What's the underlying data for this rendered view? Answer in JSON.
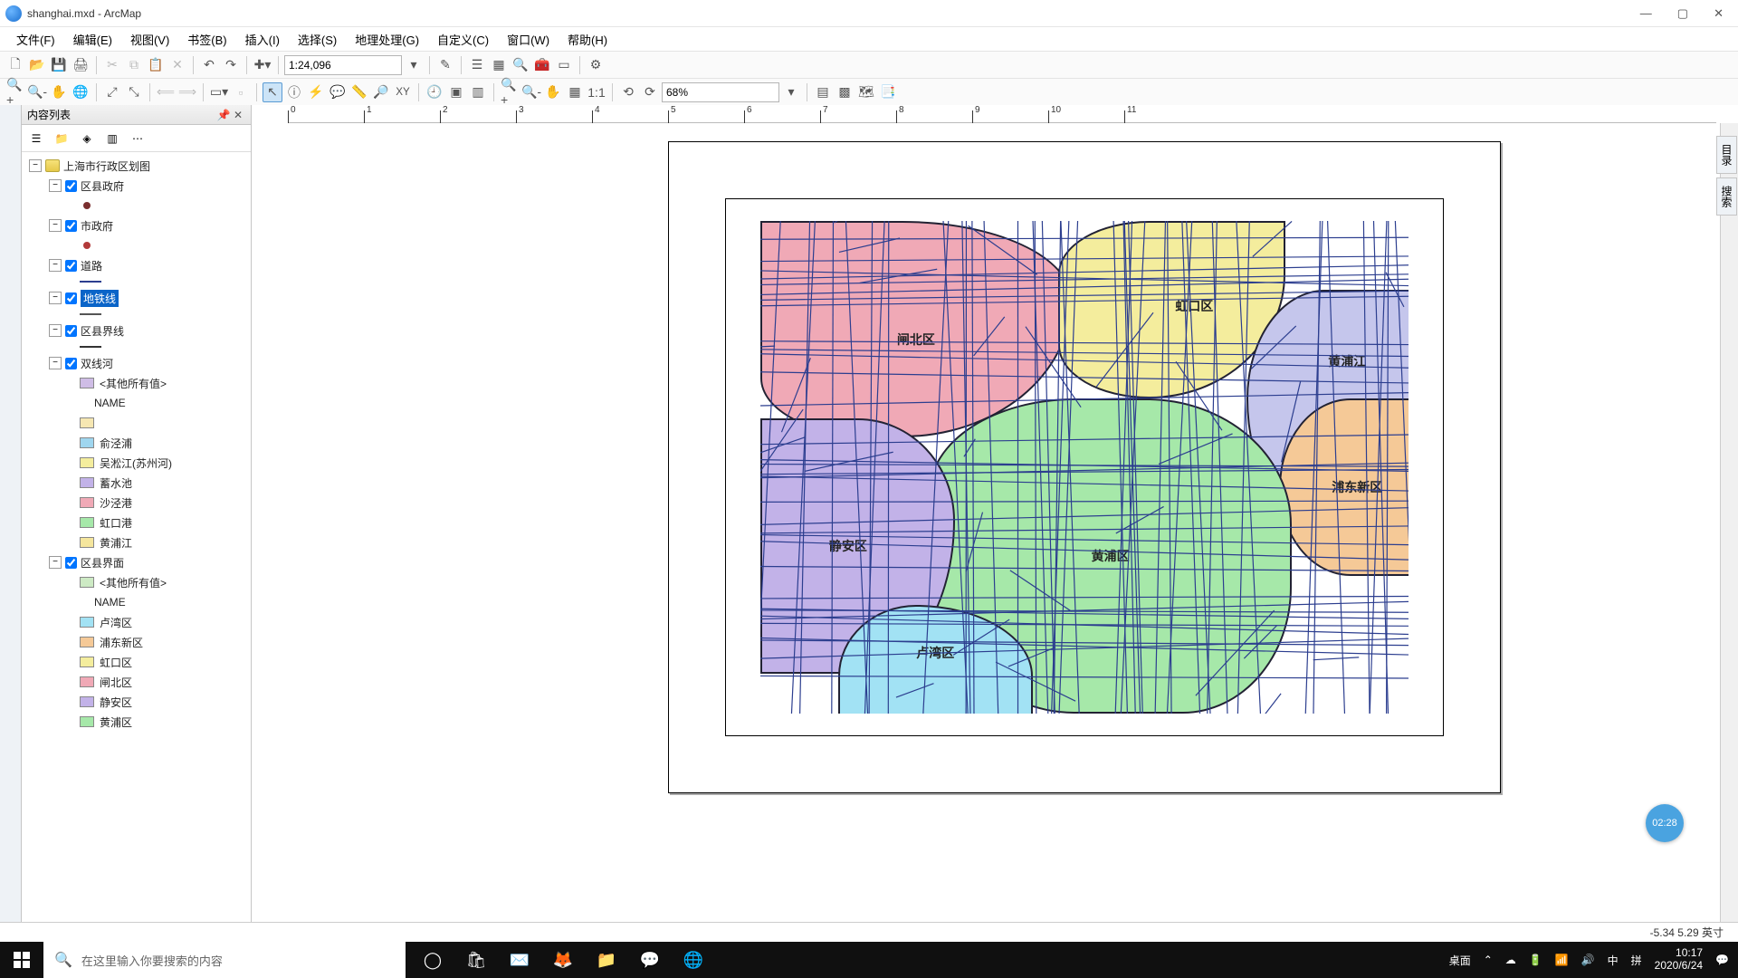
{
  "window": {
    "title": "shanghai.mxd - ArcMap"
  },
  "menu": {
    "items": [
      "文件(F)",
      "编辑(E)",
      "视图(V)",
      "书签(B)",
      "插入(I)",
      "选择(S)",
      "地理处理(G)",
      "自定义(C)",
      "窗口(W)",
      "帮助(H)"
    ]
  },
  "toolbar": {
    "scale": "1:24,096",
    "zoom_pct": "68%"
  },
  "toc": {
    "title": "内容列表",
    "root": "上海市行政区划图",
    "layers": {
      "district_gov": "区县政府",
      "city_gov": "市政府",
      "roads": "道路",
      "metro": "地铁线",
      "boundary_line": "区县界线",
      "rivers": "双线河",
      "rivers_other": "<其他所有值>",
      "rivers_name": "NAME",
      "districts": "区县界面",
      "districts_other": "<其他所有值>",
      "districts_name": "NAME"
    },
    "river_legend": [
      {
        "label": "俞泾浦",
        "color": "#9fd6ef"
      },
      {
        "label": "吴淞江(苏州河)",
        "color": "#f4ed9d"
      },
      {
        "label": "蓄水池",
        "color": "#c2b2e8"
      },
      {
        "label": "沙泾港",
        "color": "#f0a9b6"
      },
      {
        "label": "虹口港",
        "color": "#a6e8a9"
      },
      {
        "label": "黄浦江",
        "color": "#f5e69d"
      }
    ],
    "district_legend": [
      {
        "label": "卢湾区",
        "color": "#a2e2f4"
      },
      {
        "label": "浦东新区",
        "color": "#f5c997"
      },
      {
        "label": "虹口区",
        "color": "#f4ed9d"
      },
      {
        "label": "闸北区",
        "color": "#f0a9b6"
      },
      {
        "label": "静安区",
        "color": "#c2b2e8"
      },
      {
        "label": "黄浦区",
        "color": "#a6e8a9"
      }
    ]
  },
  "map": {
    "labels": {
      "zhabei": "闸北区",
      "hongkou": "虹口区",
      "huangpujiang": "黄浦江",
      "pudong": "浦东新区",
      "huangpu": "黄浦区",
      "jingan": "静安区",
      "luwan": "卢湾区"
    }
  },
  "right_panels": {
    "catalog": "目录",
    "search": "搜索"
  },
  "status": {
    "coords": "-5.34  5.29 英寸"
  },
  "badge": {
    "time": "02:28"
  },
  "taskbar": {
    "search_placeholder": "在这里输入你要搜索的内容",
    "desktop": "桌面",
    "ime1": "中",
    "ime2": "拼",
    "time": "10:17",
    "date": "2020/6/24"
  },
  "chart_data": {
    "type": "map",
    "title": "上海市行政区划图",
    "districts": [
      {
        "name": "闸北区",
        "color": "#f0a9b6"
      },
      {
        "name": "虹口区",
        "color": "#f4ed9d"
      },
      {
        "name": "黄浦江",
        "color": "#c5c6ec"
      },
      {
        "name": "浦东新区",
        "color": "#f5c997"
      },
      {
        "name": "黄浦区",
        "color": "#a6e8a9"
      },
      {
        "name": "静安区",
        "color": "#c2b2e8"
      },
      {
        "name": "卢湾区",
        "color": "#a2e2f4"
      }
    ],
    "overlays": [
      "道路",
      "地铁线",
      "区县界线",
      "双线河"
    ],
    "points": [
      "区县政府",
      "市政府"
    ],
    "scale": "1:24,096",
    "zoom": "68%",
    "ruler_unit": "英寸",
    "ruler_range": [
      0,
      11
    ]
  }
}
